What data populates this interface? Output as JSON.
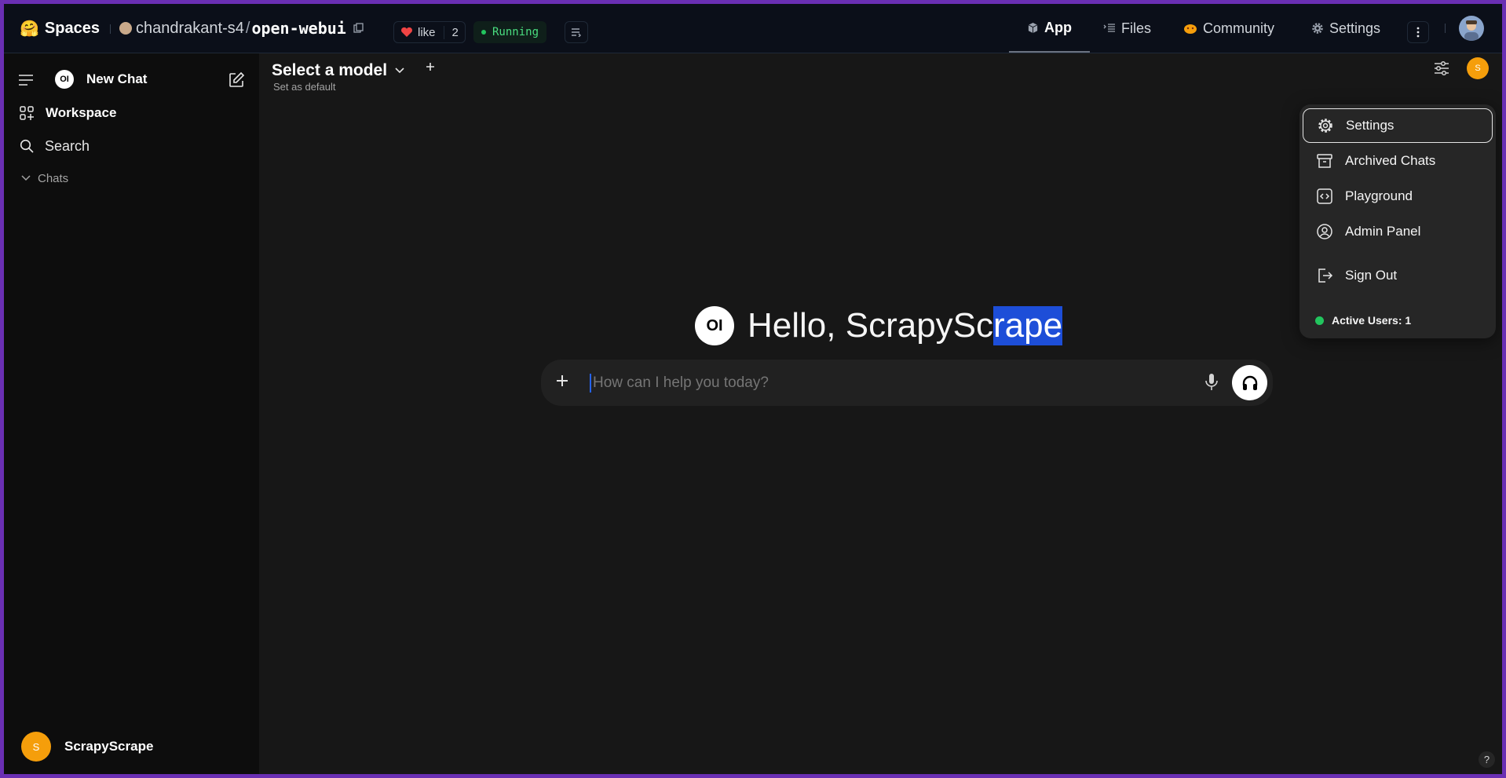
{
  "hf": {
    "logo_emoji": "🤗",
    "spaces_label": "Spaces",
    "owner": "chandrakant-s4",
    "separator": "/",
    "repo": "open-webui",
    "like_label": "like",
    "like_count": "2",
    "status": "Running",
    "nav": {
      "app": "App",
      "files": "Files",
      "community": "Community",
      "settings": "Settings"
    },
    "status_color": "#22c55e"
  },
  "sidebar": {
    "new_chat": "New Chat",
    "logo_text": "OI",
    "workspace": "Workspace",
    "search": "Search",
    "chats_section": "Chats",
    "user_initial": "S",
    "user_name": "ScrapyScrape"
  },
  "main": {
    "model_selector": "Select a model",
    "set_default": "Set as default",
    "user_initial": "S",
    "greeting_prefix": "Hello, ScrapySc",
    "greeting_selected": "rape",
    "greeting_logo": "OI",
    "input_placeholder": "How can I help you today?",
    "help": "?"
  },
  "menu": {
    "items": [
      {
        "label": "Settings",
        "icon": "gear-icon"
      },
      {
        "label": "Archived Chats",
        "icon": "archive-icon"
      },
      {
        "label": "Playground",
        "icon": "code-icon"
      },
      {
        "label": "Admin Panel",
        "icon": "user-circle-icon"
      },
      {
        "label": "Sign Out",
        "icon": "sign-out-icon"
      }
    ],
    "active_users": "Active Users: 1"
  },
  "colors": {
    "accent_orange": "#f59e0b",
    "selection": "#1d4ed8",
    "frame": "#6a2fb3"
  }
}
